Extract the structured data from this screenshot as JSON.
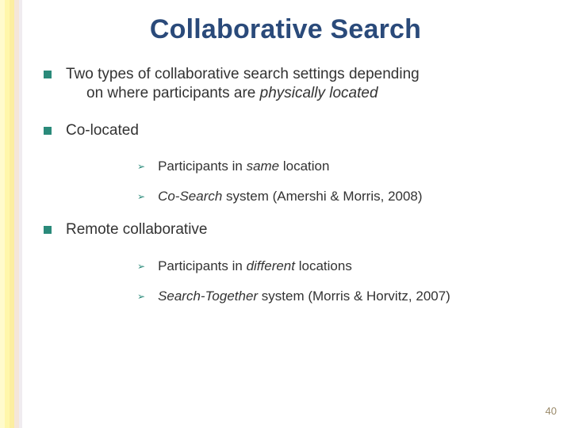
{
  "title": "Collaborative Search",
  "bullets": {
    "intro": {
      "line1": "Two types of collaborative search settings depending",
      "line2_prefix": "on where participants are ",
      "line2_ital": "physically located"
    },
    "co": {
      "heading": "Co-located",
      "p1_pre": "Participants in ",
      "p1_ital": "same",
      "p1_post": " location",
      "p2_ital": "Co-Search",
      "p2_post": " system (Amershi & Morris, 2008)"
    },
    "remote": {
      "heading": "Remote collaborative",
      "p1_pre": "Participants in ",
      "p1_ital": "different",
      "p1_post": " locations",
      "p2_ital": "Search-Together",
      "p2_post": " system (Morris & Horvitz, 2007)"
    }
  },
  "glyph": {
    "arrow": "➢"
  },
  "page_number": "40"
}
